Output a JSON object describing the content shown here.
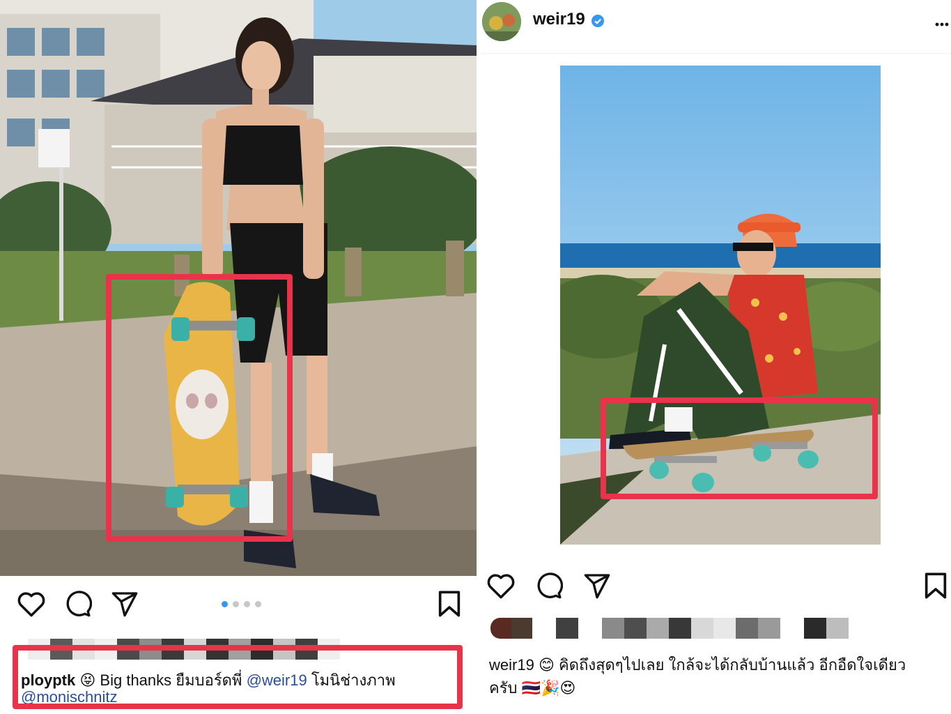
{
  "left_post": {
    "caption": {
      "username": "ployptk",
      "emoji": "😝",
      "text": "Big thanks ยืมบอร์ดพี่",
      "mention": "@weir19",
      "text_after": "โมนิช่างภาพ",
      "second_line": "@monischnitz"
    },
    "carousel": {
      "count": 4,
      "active": 1
    },
    "colors": {
      "highlight": "#e8334a",
      "mention": "#2a4f95",
      "dot_active": "#3797f0",
      "dot_inactive": "#c7c7c7"
    }
  },
  "right_post": {
    "header": {
      "username": "weir19",
      "verified_icon": "verified-badge-icon",
      "more_icon": "more-options-icon"
    },
    "caption": {
      "username": "weir19",
      "emoji_start": "😊",
      "text": "คิดถึงสุดๆไปเลย ใกล้จะได้กลับบ้านแล้ว อีกอืดใจเดียว",
      "second_line": "ครับ",
      "emoji_end": "🇹🇭🎉😍"
    }
  },
  "icons": [
    "heart-icon",
    "comment-icon",
    "share-icon",
    "bookmark-icon"
  ]
}
